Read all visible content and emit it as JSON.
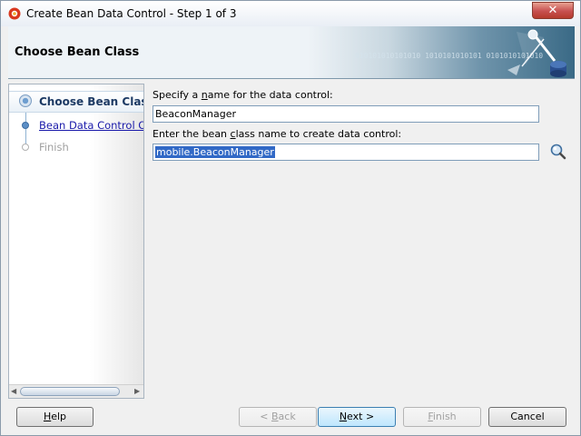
{
  "window": {
    "title": "Create Bean Data Control - Step 1 of 3",
    "close_glyph": "✕"
  },
  "banner": {
    "title": "Choose Bean Class",
    "digits": "010101010101010 1010101010101 0101010101010"
  },
  "steps": [
    {
      "label": "Choose Bean Class",
      "state": "current"
    },
    {
      "label": "Bean Data Control Options",
      "state": "link"
    },
    {
      "label": "Finish",
      "state": "disabled"
    }
  ],
  "form": {
    "name_label_pre": "Specify a ",
    "name_label_key": "n",
    "name_label_post": "ame for the data control:",
    "name_value": "BeaconManager",
    "class_label_pre": "Enter the bean ",
    "class_label_key": "c",
    "class_label_post": "lass name to create data control:",
    "class_value": "mobile.BeaconManager",
    "search_icon": "magnifier-icon"
  },
  "buttons": {
    "help": {
      "key": "H",
      "rest": "elp"
    },
    "back": {
      "pre": "< ",
      "key": "B",
      "rest": "ack"
    },
    "next": {
      "key": "N",
      "rest": "ext >"
    },
    "finish": {
      "key": "F",
      "rest": "inish"
    },
    "cancel": "Cancel"
  },
  "colors": {
    "selection": "#3169c6",
    "link": "#1a1aaa",
    "close": "#c75050"
  }
}
